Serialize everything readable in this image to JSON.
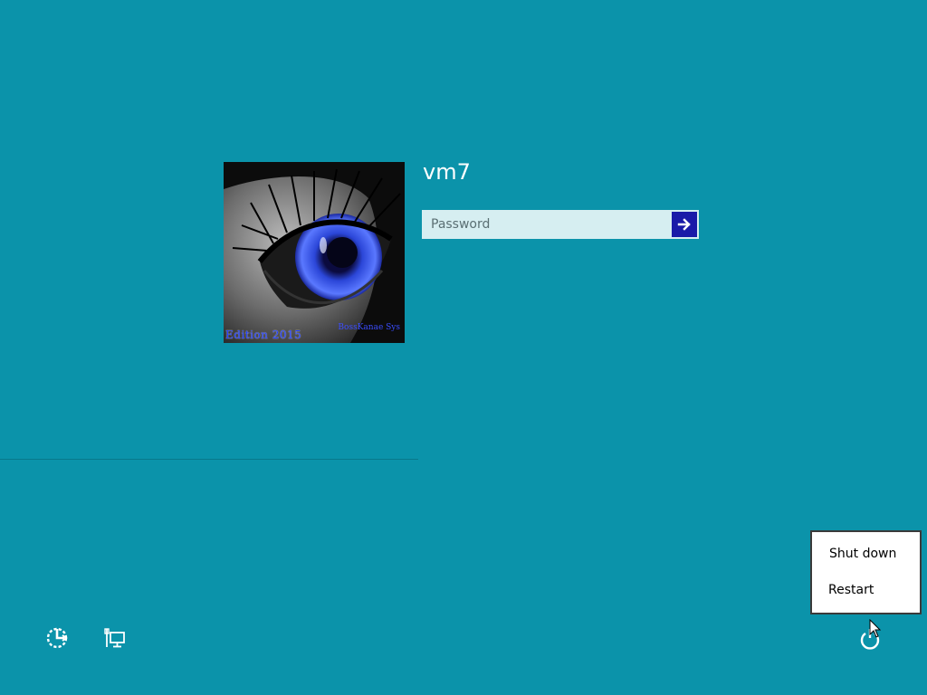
{
  "user": {
    "name": "vm7",
    "avatar_caption_left": "Edition 2015",
    "avatar_caption_right": "BossKanae Sys"
  },
  "password": {
    "placeholder": "Password",
    "value": ""
  },
  "icons": {
    "submit": "arrow-right-icon",
    "ease_of_access": "ease-of-access-icon",
    "network": "network-icon",
    "power": "power-icon"
  },
  "power_menu": {
    "items": [
      {
        "label": "Shut down"
      },
      {
        "label": "Restart"
      }
    ]
  },
  "colors": {
    "background": "#0b93aa",
    "submit_button": "#1a1aa8",
    "password_field": "#d6eef1"
  }
}
